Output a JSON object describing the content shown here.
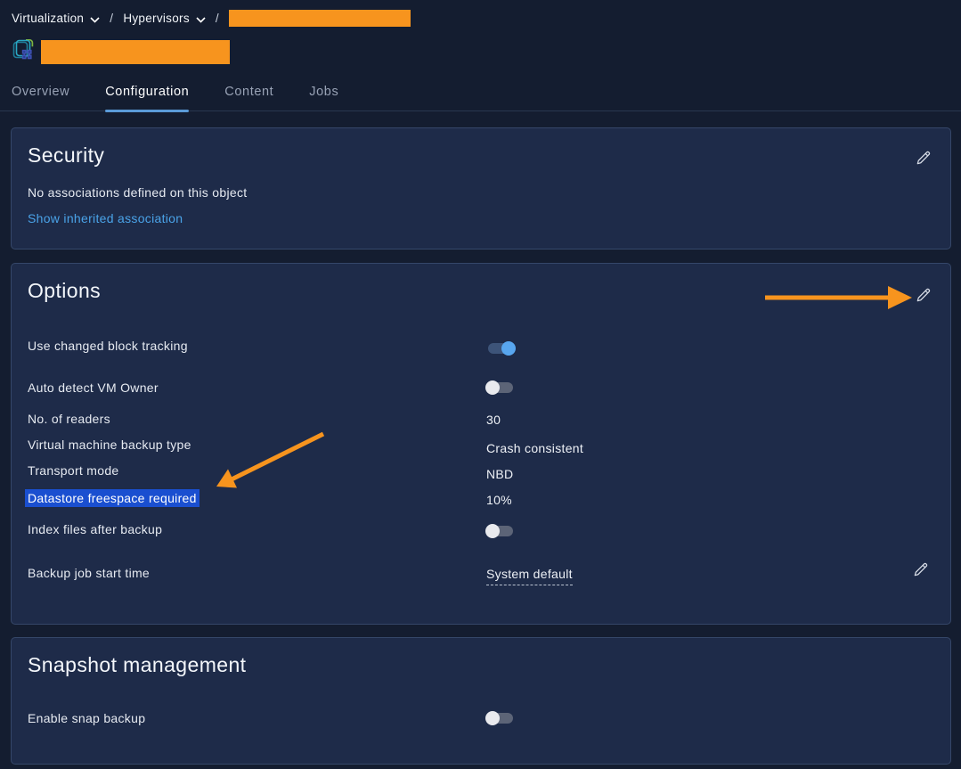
{
  "colors": {
    "accent_orange": "#F7941E",
    "link_blue": "#4AA3E8",
    "selection_blue": "#1A4FD0",
    "toggle_on_knob": "#58A6EF",
    "tab_underline": "#5B9BD8",
    "card_background": "#1E2B49",
    "page_background": "#141D30"
  },
  "icons": {
    "breadcrumb_chevron": "chevron-down",
    "edit": "pencil",
    "entity": "hypervisor-stack",
    "redaction": "orange-block"
  },
  "breadcrumb": {
    "separator": "/",
    "items": [
      {
        "label": "Virtualization"
      },
      {
        "label": "Hypervisors"
      },
      {
        "label": "",
        "redacted": true
      }
    ]
  },
  "page_title": {
    "label": "",
    "redacted": true
  },
  "tabs": [
    {
      "label": "Overview",
      "active": false
    },
    {
      "label": "Configuration",
      "active": true
    },
    {
      "label": "Content",
      "active": false
    },
    {
      "label": "Jobs",
      "active": false
    }
  ],
  "security": {
    "title": "Security",
    "empty_text": "No associations defined on this object",
    "link_text": "Show inherited association"
  },
  "options": {
    "title": "Options",
    "rows": [
      {
        "label": "Use changed block tracking",
        "type": "toggle",
        "value": true
      },
      {
        "label": "Auto detect VM Owner",
        "type": "toggle",
        "value": false
      },
      {
        "label": "No. of readers",
        "type": "text",
        "value": "30"
      },
      {
        "label": "Virtual machine backup type",
        "type": "text",
        "value": "Crash consistent"
      },
      {
        "label": "Transport mode",
        "type": "text",
        "value": "NBD"
      },
      {
        "label": "Datastore freespace required",
        "type": "text",
        "value": "10%",
        "highlighted": true
      },
      {
        "label": "Index files after backup",
        "type": "toggle",
        "value": false
      },
      {
        "label": "Backup job start time",
        "type": "editable",
        "value": "System default"
      }
    ]
  },
  "snapshot": {
    "title": "Snapshot management",
    "rows": [
      {
        "label": "Enable snap backup",
        "type": "toggle",
        "value": false
      }
    ]
  }
}
